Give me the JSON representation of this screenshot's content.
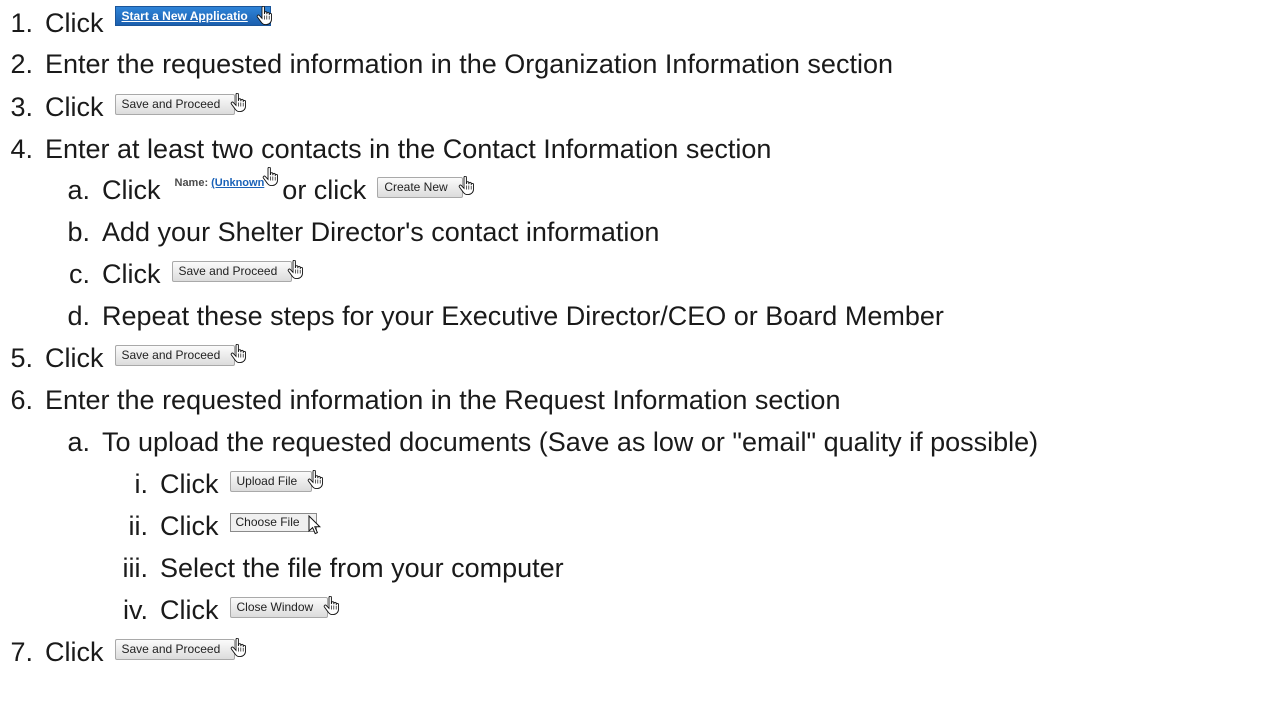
{
  "steps": {
    "s1": {
      "num": "1.",
      "text": "Click",
      "button": "Start a New Applicatio"
    },
    "s2": {
      "num": "2.",
      "text": "Enter the requested information in the Organization Information section"
    },
    "s3": {
      "num": "3.",
      "text": "Click",
      "button": "Save and Proceed"
    },
    "s4": {
      "num": "4.",
      "text": "Enter at least two contacts in the Contact Information section"
    },
    "s4a": {
      "num": "a.",
      "text": "Click",
      "link_label": "Name:",
      "link_value": "(Unknown",
      "or_text": "or click",
      "button": "Create New"
    },
    "s4b": {
      "num": "b.",
      "text": "Add your Shelter Director's contact information"
    },
    "s4c": {
      "num": "c.",
      "text": "Click",
      "button": "Save and Proceed"
    },
    "s4d": {
      "num": "d.",
      "text": "Repeat these steps for your Executive Director/CEO or Board Member"
    },
    "s5": {
      "num": "5.",
      "text": "Click",
      "button": "Save and Proceed"
    },
    "s6": {
      "num": "6.",
      "text": "Enter the requested information in the Request Information section"
    },
    "s6a": {
      "num": "a.",
      "text": "To upload the requested documents (Save as low or \"email\" quality if possible)"
    },
    "s6a1": {
      "num": "i.",
      "text": "Click",
      "button": "Upload File"
    },
    "s6a2": {
      "num": "ii.",
      "text": "Click",
      "button": "Choose File"
    },
    "s6a3": {
      "num": "iii.",
      "text": "Select the file from your computer"
    },
    "s6a4": {
      "num": "iv.",
      "text": "Click",
      "button": "Close Window"
    },
    "s7": {
      "num": "7.",
      "text": "Click",
      "button": "Save and Proceed"
    }
  },
  "icons": {
    "hand": "hand-pointer-cursor-icon",
    "arrow": "arrow-pointer-cursor-icon"
  },
  "colors": {
    "primary_button": "#1f6cc0",
    "link": "#1a62b8"
  }
}
